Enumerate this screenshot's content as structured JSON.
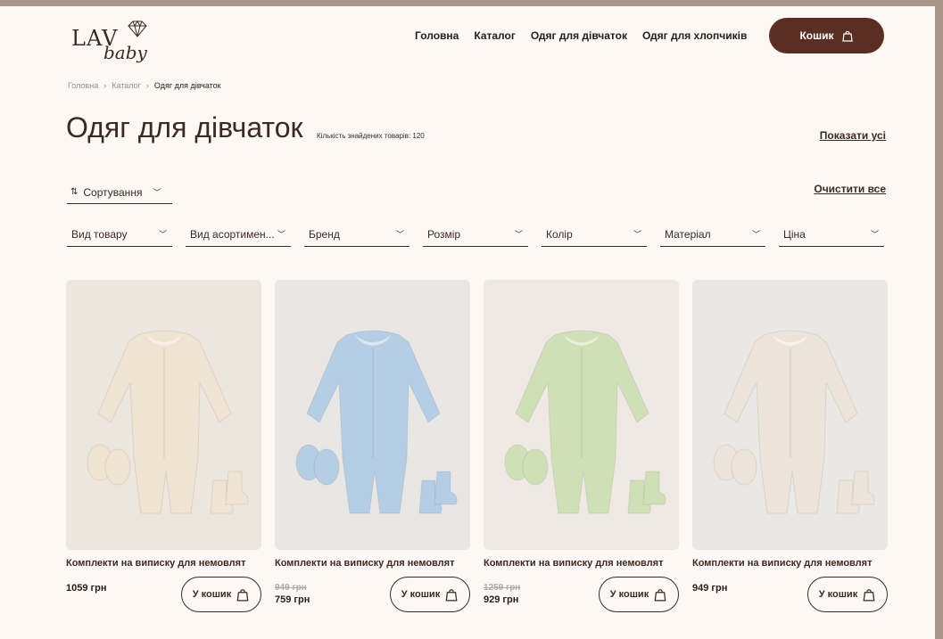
{
  "logo": {
    "word": "LAV",
    "script": "baby"
  },
  "nav": {
    "items": [
      "Головна",
      "Каталог",
      "Одяг для дівчаток",
      "Одяг для хлопчиків"
    ],
    "cart_label": "Кошик"
  },
  "breadcrumb": {
    "items": [
      "Головна",
      "Каталог",
      "Одяг для дівчаток"
    ]
  },
  "page": {
    "title": "Одяг для дівчаток",
    "found_label": "Кількість знайдених товарів: 120",
    "show_all": "Показати усі"
  },
  "toolbar": {
    "sort_label": "Сортування",
    "clear_all": "Очистити все"
  },
  "filters": [
    "Вид товару",
    "Вид асортимен...",
    "Бренд",
    "Розмір",
    "Колір",
    "Матеріал",
    "Ціна"
  ],
  "products": [
    {
      "name": "Комплекти на виписку для немовлят",
      "old_price": "",
      "price": "1059 грн",
      "buy_label": "У кошик",
      "bg": "#ece6df",
      "color": "#efe3d2"
    },
    {
      "name": "Комплекти на виписку для немовлят",
      "old_price": "949 грн",
      "price": "759 грн",
      "buy_label": "У кошик",
      "bg": "#e8e7e3",
      "color": "#b6cde6"
    },
    {
      "name": "Комплекти на виписку для немовлят",
      "old_price": "1259 грн",
      "price": "929 грн",
      "buy_label": "У кошик",
      "bg": "#efe8e3",
      "color": "#cfe0b7"
    },
    {
      "name": "Комплекти на виписку для немовлят",
      "old_price": "",
      "price": "949 грн",
      "buy_label": "У кошик",
      "bg": "#e9e8e4",
      "color": "#ece4d8"
    }
  ],
  "colors": {
    "accent": "#5a2e22",
    "text": "#3b2a22",
    "background": "#fdf8f3"
  }
}
